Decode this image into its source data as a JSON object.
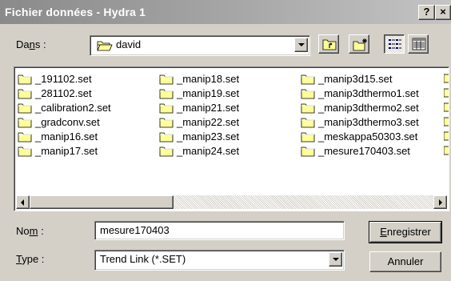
{
  "window": {
    "title": "Fichier données - Hydra 1",
    "help_button": "?",
    "close_button": "×"
  },
  "lookin": {
    "label_pre": "Da",
    "label_u": "n",
    "label_post": "s :",
    "value": "david"
  },
  "files": {
    "col1": [
      "_191102.set",
      "_281102.set",
      "_calibration2.set",
      "_gradconv.set",
      "_manip16.set",
      "_manip17.set"
    ],
    "col2": [
      "_manip18.set",
      "_manip19.set",
      "_manip21.set",
      "_manip22.set",
      "_manip23.set",
      "_manip24.set"
    ],
    "col3": [
      "_manip3d15.set",
      "_manip3dthermo1.set",
      "_manip3dthermo2.set",
      "_manip3dthermo3.set",
      "_meskappa50303.set",
      "_mesure170403.set"
    ]
  },
  "filename": {
    "label_pre": "No",
    "label_u": "m",
    "label_post": " :",
    "value": "mesure170403"
  },
  "filetype": {
    "label_u": "T",
    "label_post": "ype :",
    "value": "Trend Link (*.SET)"
  },
  "buttons": {
    "save_u": "E",
    "save_rest": "nregistrer",
    "cancel": "Annuler"
  },
  "colors": {
    "face": "#d4d0c8",
    "folder": "#ffff99",
    "titlebar": "#a8a8a8"
  }
}
